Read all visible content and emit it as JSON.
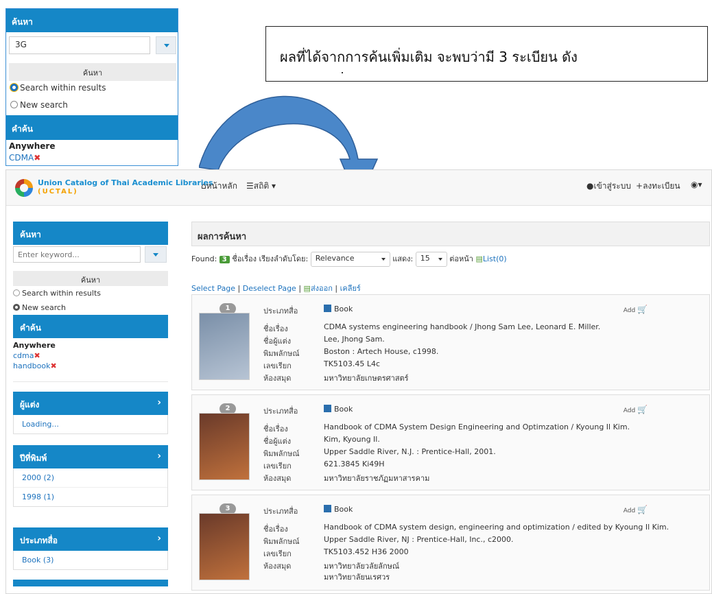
{
  "inset": {
    "header": "ค้นหา",
    "query_value": "3G",
    "search_button": "ค้นหา",
    "opt_within": "Search within results",
    "opt_new": "New search",
    "terms_header": "คำค้น",
    "anywhere": "Anywhere",
    "term1": "CDMA"
  },
  "callout": {
    "text": "ผลที่ได้จากการค้นเพิ่มเติม จะพบว่ามี 3 ระเบียน ดัง"
  },
  "nav": {
    "brand_line1": "Union Catalog of Thai Academic Libraries",
    "brand_line2": "(UCTAL)",
    "home": "หน้าหลัก",
    "stats": "สถิติ",
    "login": "เข้าสู่ระบบ",
    "register": "ลงทะเบียน"
  },
  "sidebar": {
    "search_header": "ค้นหา",
    "keyword_placeholder": "Enter keyword...",
    "search_button": "ค้นหา",
    "opt_within": "Search within results",
    "opt_new": "New search",
    "terms_header": "คำค้น",
    "anywhere": "Anywhere",
    "term1": "cdma",
    "term2": "handbook",
    "author_header": "ผู้แต่ง",
    "author_loading": "Loading...",
    "year_header": "ปีที่พิมพ์",
    "years": [
      "2000 (2)",
      "1998 (1)"
    ],
    "type_header": "ประเภทสื่อ",
    "types": [
      "Book (3)"
    ]
  },
  "results": {
    "header": "ผลการค้นหา",
    "found_label": "Found:",
    "found_count": "3",
    "sort_label": "ชื่อเรื่อง เรียงลำดับโดย:",
    "sort_value": "Relevance",
    "show_label": "แสดง:",
    "per_page": "15",
    "per_page_label": "ต่อหน้า",
    "list_label": "List(0)",
    "select_page": "Select Page",
    "deselect_page": "Deselect Page",
    "export": "ส่งออก",
    "clear": "เคลียร์",
    "add_label": "Add",
    "labels": {
      "type": "ประเภทสื่อ",
      "title": "ชื่อเรื่อง",
      "author": "ชื่อผู้แต่ง",
      "publisher": "พิมพลักษณ์",
      "callno": "เลขเรียก",
      "library": "ห้องสมุด"
    },
    "items": [
      {
        "num": "1",
        "type": "Book",
        "title": "CDMA systems engineering handbook / Jhong Sam Lee, Leonard E. Miller.",
        "author": "Lee, Jhong Sam.",
        "publisher": "Boston : Artech House, c1998.",
        "callno": "TK5103.45 L4c",
        "library": "มหาวิทยาลัยเกษตรศาสตร์"
      },
      {
        "num": "2",
        "type": "Book",
        "title": "Handbook of CDMA System Design Engineering and Optimzation / Kyoung Il Kim.",
        "author": "Kim, Kyoung Il.",
        "publisher": "Upper Saddle River, N.J. : Prentice-Hall, 2001.",
        "callno": "621.3845 Ki49H",
        "library": "มหาวิทยาลัยราชภัฏมหาสารคาม"
      },
      {
        "num": "3",
        "type": "Book",
        "title": "Handbook of CDMA system design, engineering and optimization / edited by Kyoung Il Kim.",
        "publisher": "Upper Saddle River, NJ : Prentice-Hall, Inc., c2000.",
        "callno": "TK5103.452 H36 2000",
        "library": "มหาวิทยาลัยวลัยลักษณ์",
        "library2": "มหาวิทยาลัยนเรศวร"
      }
    ]
  }
}
